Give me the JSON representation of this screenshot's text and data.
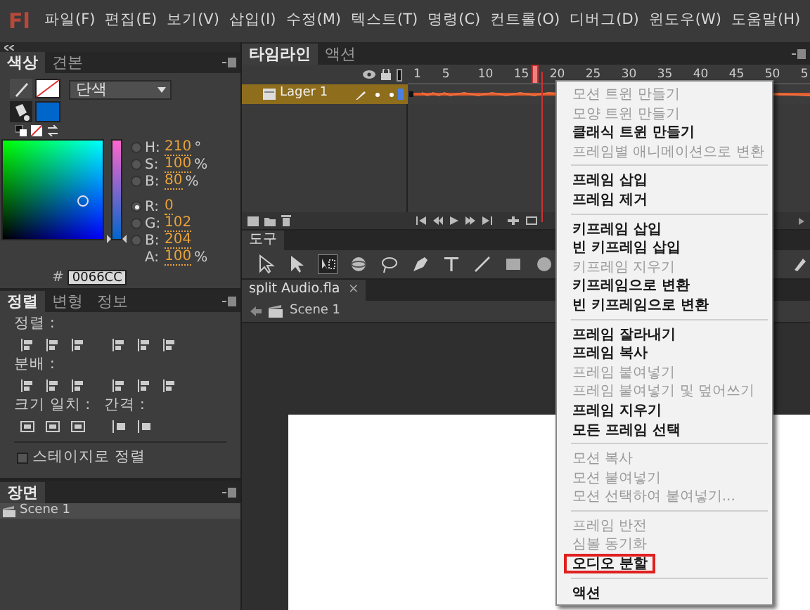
{
  "app": {
    "logo": "Fl"
  },
  "menu_bar": [
    "파일(F)",
    "편집(E)",
    "보기(V)",
    "삽입(I)",
    "수정(M)",
    "텍스트(T)",
    "명령(C)",
    "컨트롤(O)",
    "디버그(D)",
    "윈도우(W)",
    "도움말(H)"
  ],
  "color_panel": {
    "tabs": [
      {
        "label": "색상",
        "selected": true
      },
      {
        "label": "견본",
        "selected": false
      }
    ],
    "fill_type": "단색",
    "fields": [
      {
        "label": "H:",
        "value": "210",
        "unit": "°",
        "selected": false
      },
      {
        "label": "S:",
        "value": "100",
        "unit": "%",
        "selected": false
      },
      {
        "label": "B:",
        "value": "80",
        "unit": "%",
        "selected": false
      },
      {
        "label": "R:",
        "value": "0",
        "selected": true
      },
      {
        "label": "G:",
        "value": "102",
        "selected": false
      },
      {
        "label": "B:",
        "value": "204",
        "selected": false
      },
      {
        "label": "A:",
        "value": "100",
        "unit": "%"
      }
    ],
    "slider": {
      "level": 0
    },
    "hex_label": "#",
    "hex": "0066CC"
  },
  "align_panel": {
    "tabs": [
      {
        "label": "정렬",
        "selected": true
      },
      {
        "label": "변형",
        "selected": false
      },
      {
        "label": "정보",
        "selected": false
      }
    ],
    "sections": [
      {
        "label": "정렬 :"
      },
      {
        "label": "분배 :"
      },
      {
        "label": "크기 일치 :",
        "label_2": "간격 :"
      }
    ],
    "stage_checkbox": {
      "label": "스테이지로 정렬",
      "checked": false
    }
  },
  "scene_panel": {
    "tabs": [
      {
        "label": "장면",
        "selected": true
      }
    ],
    "scenes": [
      {
        "name": "Scene 1",
        "selected": true
      }
    ]
  },
  "timeline": {
    "tabs": [
      {
        "label": "타임라인",
        "selected": true
      },
      {
        "label": "액션",
        "selected": false
      }
    ],
    "frame_numbers": [
      "1",
      "5",
      "10",
      "15",
      "20",
      "25",
      "30",
      "35",
      "40",
      "45",
      "50",
      "5"
    ],
    "layers": [
      {
        "name": "Lager 1",
        "selected": true
      }
    ]
  },
  "tools_panel": {
    "title": "도구"
  },
  "document_tab": {
    "label": "split Audio.fla",
    "close": "×"
  },
  "scene_bar": {
    "scene": "Scene 1"
  },
  "context_menu": {
    "items": [
      {
        "kind": "item",
        "label": "모션 트윈 만들기",
        "disabled": true,
        "highlighted": false
      },
      {
        "kind": "item",
        "label": "모양 트윈 만들기",
        "disabled": true,
        "highlighted": false
      },
      {
        "kind": "item",
        "label": "클래식 트윈 만들기",
        "disabled": false,
        "highlighted": false
      },
      {
        "kind": "item",
        "label": "프레임별 애니메이션으로 변환",
        "disabled": true,
        "highlighted": false
      },
      {
        "kind": "separator"
      },
      {
        "kind": "item",
        "label": "프레임 삽입",
        "disabled": false,
        "highlighted": false
      },
      {
        "kind": "item",
        "label": "프레임 제거",
        "disabled": false,
        "highlighted": false
      },
      {
        "kind": "separator"
      },
      {
        "kind": "item",
        "label": "키프레임 삽입",
        "disabled": false,
        "highlighted": false
      },
      {
        "kind": "item",
        "label": "빈 키프레임 삽입",
        "disabled": false,
        "highlighted": false
      },
      {
        "kind": "item",
        "label": "키프레임 지우기",
        "disabled": true,
        "highlighted": false
      },
      {
        "kind": "item",
        "label": "키프레임으로 변환",
        "disabled": false,
        "highlighted": false
      },
      {
        "kind": "item",
        "label": "빈 키프레임으로 변환",
        "disabled": false,
        "highlighted": false
      },
      {
        "kind": "separator"
      },
      {
        "kind": "item",
        "label": "프레임 잘라내기",
        "disabled": false,
        "highlighted": false
      },
      {
        "kind": "item",
        "label": "프레임 복사",
        "disabled": false,
        "highlighted": false
      },
      {
        "kind": "item",
        "label": "프레임 붙여넣기",
        "disabled": true,
        "highlighted": false
      },
      {
        "kind": "item",
        "label": "프레임 붙여넣기 및 덮어쓰기",
        "disabled": true,
        "highlighted": false
      },
      {
        "kind": "item",
        "label": "프레임 지우기",
        "disabled": false,
        "highlighted": false
      },
      {
        "kind": "item",
        "label": "모든 프레임 선택",
        "disabled": false,
        "highlighted": false
      },
      {
        "kind": "separator"
      },
      {
        "kind": "item",
        "label": "모션 복사",
        "disabled": true,
        "highlighted": false
      },
      {
        "kind": "item",
        "label": "모션 붙여넣기",
        "disabled": true,
        "highlighted": false
      },
      {
        "kind": "item",
        "label": "모션 선택하여 붙여넣기...",
        "disabled": true,
        "highlighted": false
      },
      {
        "kind": "separator"
      },
      {
        "kind": "item",
        "label": "프레임 반전",
        "disabled": true,
        "highlighted": false
      },
      {
        "kind": "item",
        "label": "심볼 동기화",
        "disabled": true,
        "highlighted": false
      },
      {
        "kind": "item",
        "label": "오디오 분할",
        "disabled": false,
        "highlighted": true
      },
      {
        "kind": "separator"
      },
      {
        "kind": "item",
        "label": "액션",
        "disabled": false,
        "highlighted": false
      }
    ]
  }
}
